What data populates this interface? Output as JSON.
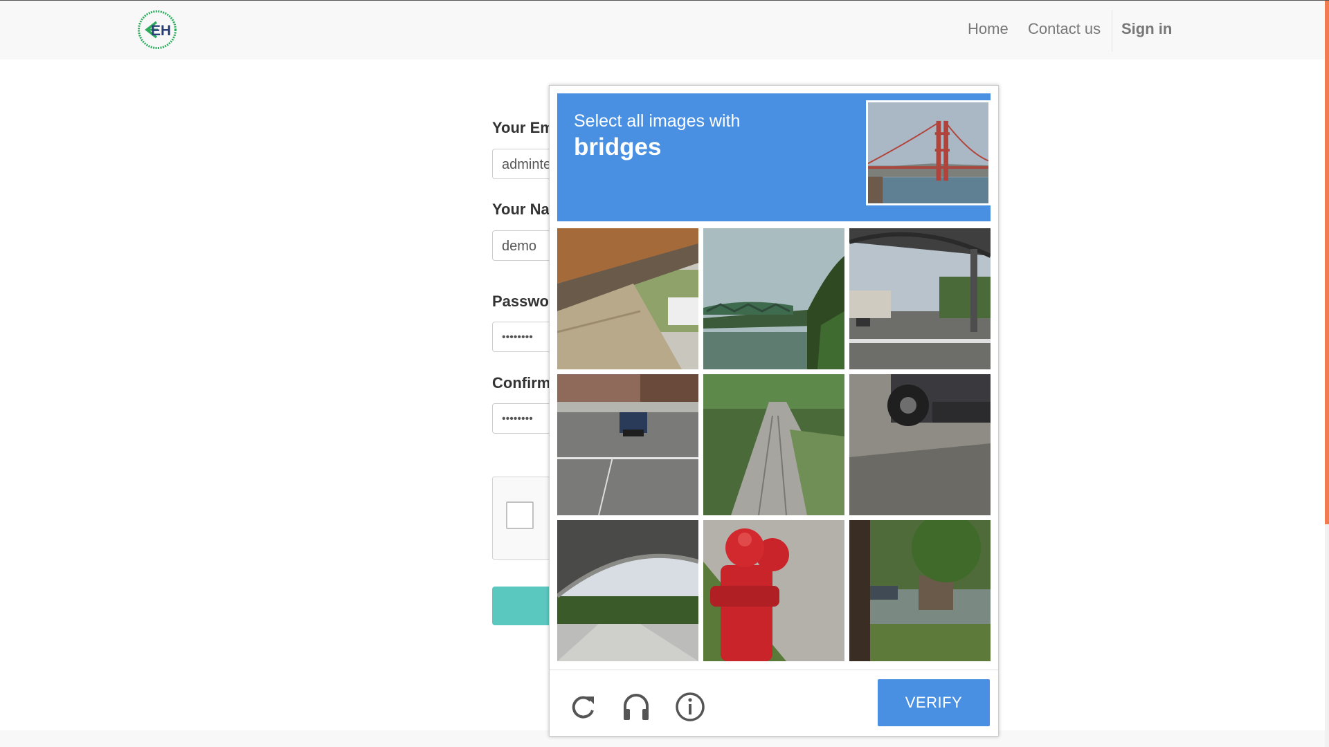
{
  "header": {
    "logo_text": "EH",
    "nav": {
      "home": "Home",
      "contact": "Contact us",
      "signin": "Sign in"
    }
  },
  "form": {
    "email_label": "Your Em",
    "email_value": "adminte",
    "name_label": "Your Na",
    "name_value": "demo",
    "password_label": "Passwo",
    "password_value": "••••••••",
    "confirm_label": "Confirm",
    "confirm_value": "••••••••"
  },
  "recaptcha": {
    "instruction": "Select all images with",
    "target": "bridges",
    "verify_label": "VERIFY",
    "accent_color": "#4a90e2",
    "icons": [
      "reload-icon",
      "audio-headphones-icon",
      "info-icon"
    ]
  },
  "colors": {
    "submit_button": "#5bc8c0",
    "scrollbar_thumb": "#f07c4f",
    "logo_green": "#2eaa5c",
    "logo_navy": "#2a3f7a"
  }
}
